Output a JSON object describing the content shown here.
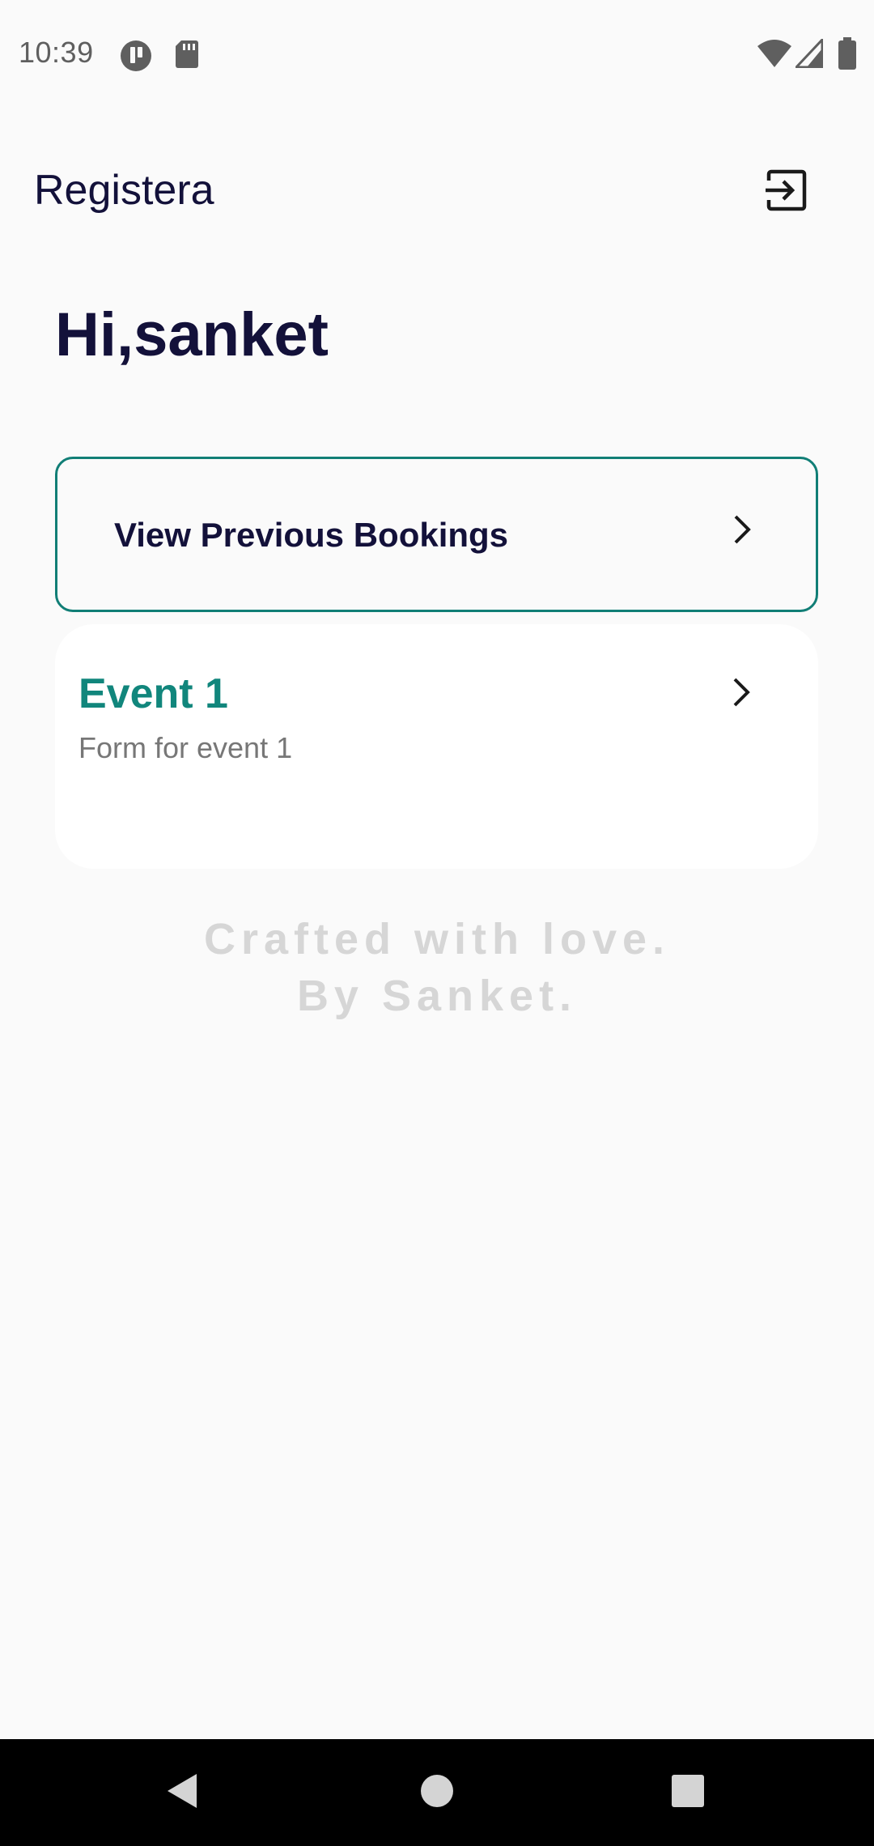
{
  "status_bar": {
    "time": "10:39",
    "icons": [
      "notification-app-icon",
      "sd-card-icon",
      "wifi-icon",
      "signal-icon",
      "battery-icon"
    ]
  },
  "app_bar": {
    "title": "Registera",
    "logout_icon": "logout-icon"
  },
  "greeting": "Hi,sanket",
  "bookings": {
    "label": "View Previous Bookings",
    "chevron_icon": "chevron-right-icon",
    "border_color": "#117e76"
  },
  "events": [
    {
      "title": "Event 1",
      "subtitle": "Form for event 1",
      "chevron_icon": "chevron-right-icon",
      "title_color": "#11867c"
    }
  ],
  "footer": {
    "line1": "Crafted with love.",
    "line2": "By Sanket."
  },
  "nav_bar": {
    "buttons": [
      "back-icon",
      "home-icon",
      "recents-icon"
    ]
  },
  "colors": {
    "background": "#fafafa",
    "primary_text": "#13113a",
    "accent": "#117e76"
  }
}
